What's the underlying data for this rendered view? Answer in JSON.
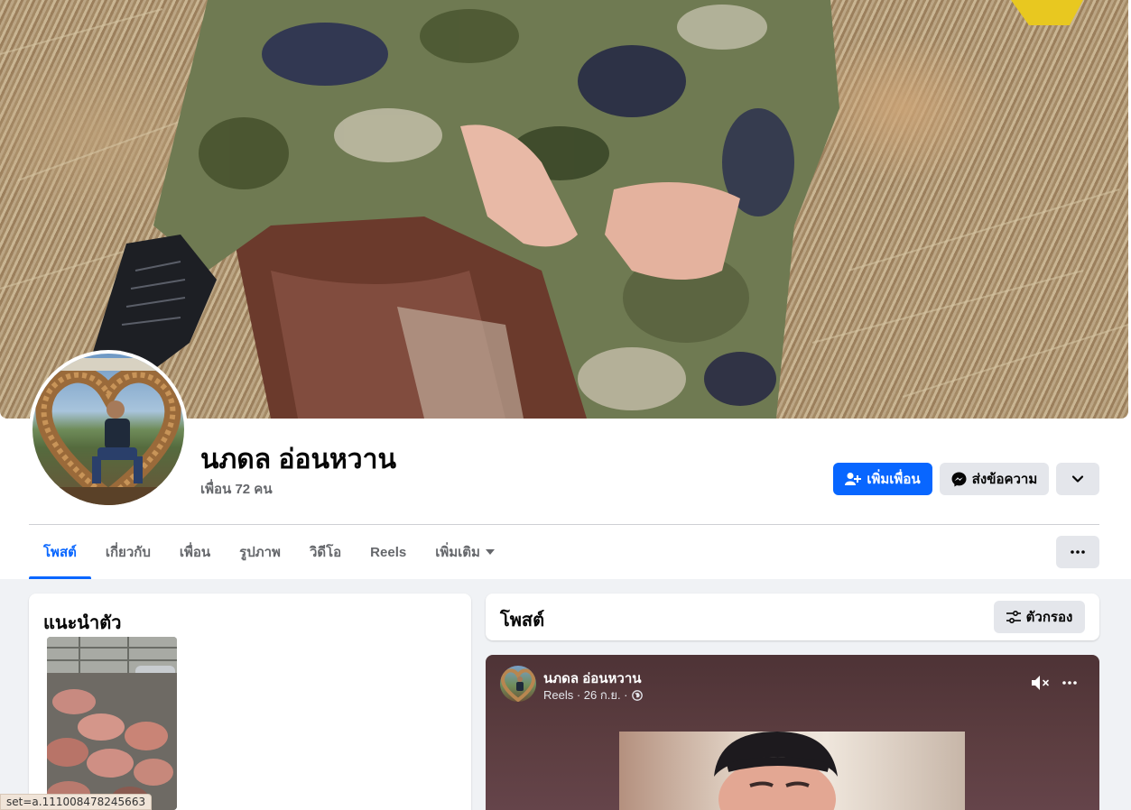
{
  "profile": {
    "name": "นภดล อ่อนหวาน",
    "friends": "เพื่อน 72 คน"
  },
  "actions": {
    "add_friend": "เพิ่มเพื่อน",
    "message": "ส่งข้อความ"
  },
  "tabs": [
    {
      "label": "โพสต์",
      "active": true
    },
    {
      "label": "เกี่ยวกับ",
      "active": false
    },
    {
      "label": "เพื่อน",
      "active": false
    },
    {
      "label": "รูปภาพ",
      "active": false
    },
    {
      "label": "วิดีโอ",
      "active": false
    },
    {
      "label": "Reels",
      "active": false
    },
    {
      "label": "เพิ่มเติม",
      "active": false
    }
  ],
  "intro": {
    "title": "แนะนำตัว"
  },
  "posts": {
    "title": "โพสต์",
    "filter_label": "ตัวกรอง"
  },
  "post": {
    "author": "นภดล อ่อนหวาน",
    "meta": "Reels · 26 ก.ย. ·"
  },
  "status_bar": {
    "url": "set=a.111008478245663"
  },
  "colors": {
    "accent": "#0866ff",
    "page_bg": "#f0f2f5",
    "reel_bg": "#4e3336"
  },
  "icons": [
    "add-friend-icon",
    "messenger-icon",
    "chevron-down-icon",
    "more-icon",
    "filter-icon",
    "mute-icon",
    "globe-icon"
  ]
}
